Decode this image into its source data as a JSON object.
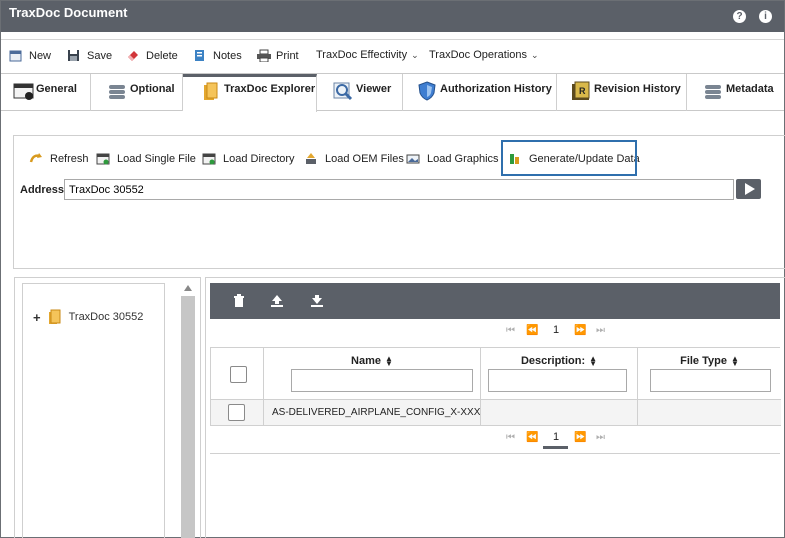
{
  "window": {
    "title": "TraxDoc Document",
    "help_icon": "?",
    "info_icon": "i"
  },
  "toolbar": {
    "new": "New",
    "save": "Save",
    "delete": "Delete",
    "notes": "Notes",
    "print": "Print",
    "effectivity": "TraxDoc Effectivity",
    "operations": "TraxDoc Operations"
  },
  "tabs": {
    "general": "General",
    "optional": "Optional",
    "explorer": "TraxDoc Explorer",
    "viewer": "Viewer",
    "auth": "Authorization History",
    "revision": "Revision History",
    "metadata": "Metadata"
  },
  "explorer": {
    "refresh": "Refresh",
    "load_single": "Load Single File",
    "load_dir": "Load Directory",
    "load_oem": "Load OEM Files",
    "load_graphics": "Load Graphics",
    "generate": "Generate/Update Data",
    "address_label": "Address:",
    "address_value": "TraxDoc 30552"
  },
  "tree": {
    "root": "TraxDoc 30552"
  },
  "grid": {
    "page": "1",
    "columns": {
      "name": "Name",
      "description": "Description:",
      "filetype": "File Type"
    },
    "rows": [
      {
        "name": "AS-DELIVERED_AIRPLANE_CONFIG_X-XXXX_EXCEL",
        "description": "",
        "filetype": ""
      }
    ]
  },
  "colors": {
    "header": "#5b6068",
    "accent_box": "#2f6fad"
  }
}
